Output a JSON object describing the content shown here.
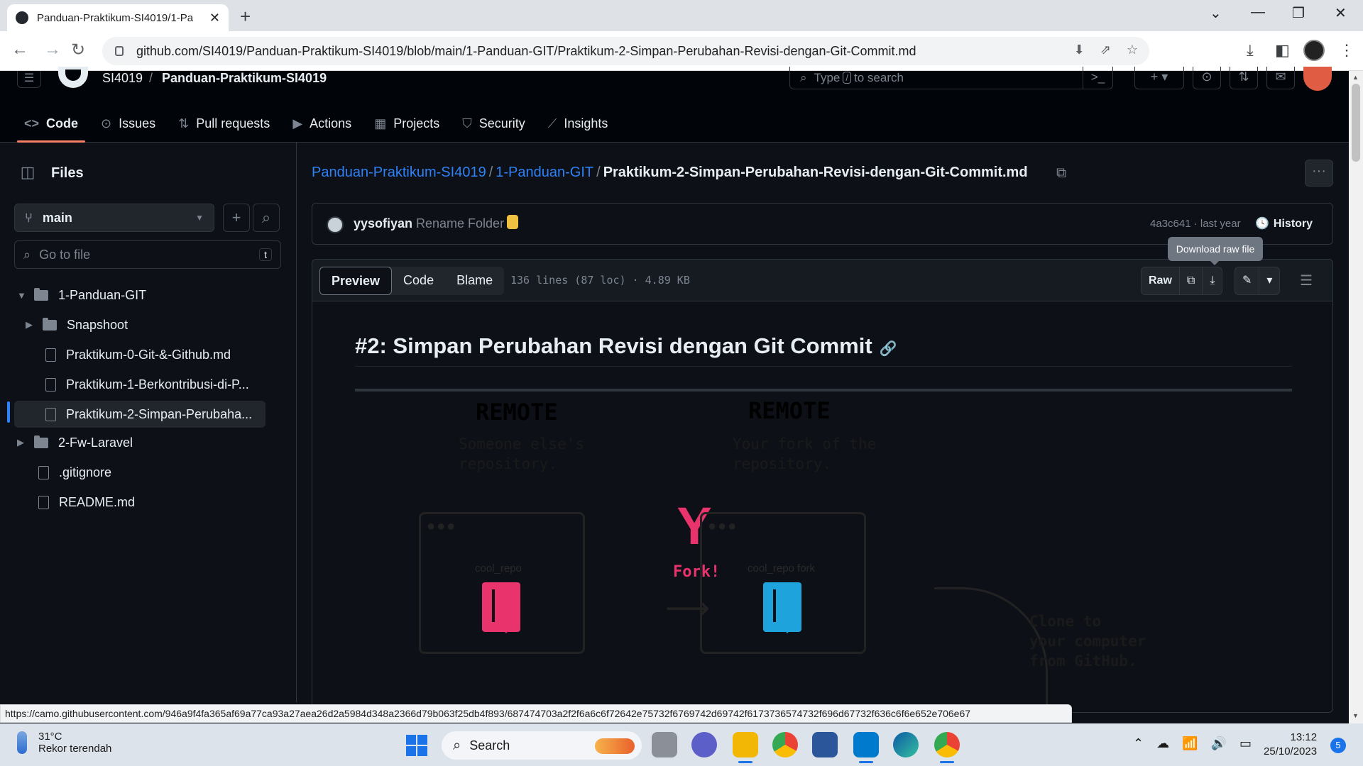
{
  "browser": {
    "tab_title": "Panduan-Praktikum-SI4019/1-Pa",
    "url": "github.com/SI4019/Panduan-Praktikum-SI4019/blob/main/1-Panduan-GIT/Praktikum-2-Simpan-Perubahan-Revisi-dengan-Git-Commit.md",
    "status_url": "https://camo.githubusercontent.com/946a9f4fa365af69a77ca93a27aea26d2a5984d348a2366d79b063f25db4f893/687474703a2f2f6a6c6f72642e75732f6769742d69742f6173736574732f696d67732f636c6f6e652e706e67"
  },
  "github": {
    "owner": "SI4019",
    "repo": "Panduan-Praktikum-SI4019",
    "search_prefix": "Type",
    "search_key": "/",
    "search_suffix": "to search",
    "nav": [
      {
        "label": "Code",
        "icon": "code-icon",
        "glyph": "<>"
      },
      {
        "label": "Issues",
        "icon": "issue-icon",
        "glyph": "⊙"
      },
      {
        "label": "Pull requests",
        "icon": "pull-request-icon",
        "glyph": "⇅"
      },
      {
        "label": "Actions",
        "icon": "play-icon",
        "glyph": "▶"
      },
      {
        "label": "Projects",
        "icon": "table-icon",
        "glyph": "▦"
      },
      {
        "label": "Security",
        "icon": "shield-icon",
        "glyph": "⛉"
      },
      {
        "label": "Insights",
        "icon": "graph-icon",
        "glyph": "📈"
      }
    ]
  },
  "sidebar": {
    "title": "Files",
    "branch": "main",
    "goto_placeholder": "Go to file",
    "goto_key": "t",
    "tree": [
      {
        "label": "1-Panduan-GIT",
        "type": "folder",
        "expanded": true,
        "level": 0
      },
      {
        "label": "Snapshoot",
        "type": "folder",
        "expanded": false,
        "level": 1
      },
      {
        "label": "Praktikum-0-Git-&-Github.md",
        "type": "file",
        "level": 1
      },
      {
        "label": "Praktikum-1-Berkontribusi-di-P...",
        "type": "file",
        "level": 1
      },
      {
        "label": "Praktikum-2-Simpan-Perubaha...",
        "type": "file",
        "level": 1,
        "selected": true
      },
      {
        "label": "2-Fw-Laravel",
        "type": "folder",
        "expanded": false,
        "level": 0
      },
      {
        "label": ".gitignore",
        "type": "file",
        "level": 0
      },
      {
        "label": "README.md",
        "type": "file",
        "level": 0
      }
    ]
  },
  "breadcrumb": {
    "root": "Panduan-Praktikum-SI4019",
    "folder": "1-Panduan-GIT",
    "file": "Praktikum-2-Simpan-Perubahan-Revisi-dengan-Git-Commit.md"
  },
  "commit": {
    "author": "yysofiyan",
    "message": "Rename Folder",
    "hash_time": "4a3c641 · last year",
    "history_label": "History"
  },
  "file_view": {
    "tabs": [
      "Preview",
      "Code",
      "Blame"
    ],
    "active_tab": "Preview",
    "info": "136 lines (87 loc) · 4.89 KB",
    "raw_label": "Raw",
    "tooltip": "Download raw file"
  },
  "markdown": {
    "title": "#2: Simpan Perubahan Revisi dengan Git Commit",
    "illustration": {
      "remote_left": "REMOTE",
      "remote_left_sub1": "Someone else's",
      "remote_left_sub2": "repository.",
      "remote_right": "REMOTE",
      "remote_right_sub1": "Your fork of the",
      "remote_right_sub2": "repository.",
      "repo_left": "cool_repo",
      "repo_right": "cool_repo fork",
      "fork_label": "Fork!",
      "clone1": "Clone to",
      "clone2": "your computer",
      "clone3": "from GitHub."
    }
  },
  "taskbar": {
    "temp": "31°C",
    "weather": "Rekor terendah",
    "search": "Search",
    "time": "13:12",
    "date": "25/10/2023",
    "notifications": "5"
  }
}
